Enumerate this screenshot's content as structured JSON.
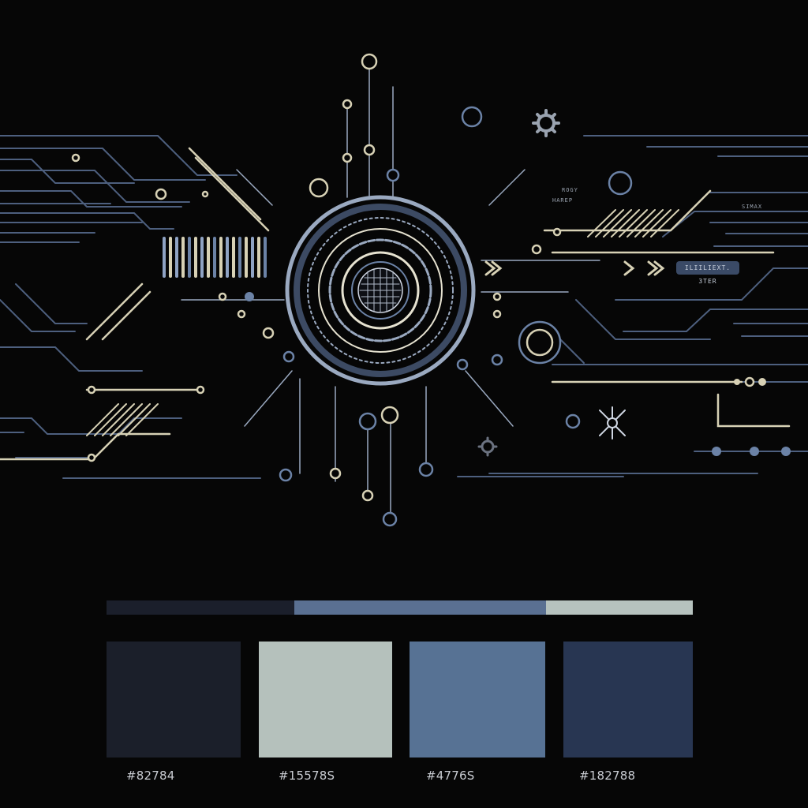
{
  "artwork": {
    "readouts": {
      "top_right": "ROGY",
      "mid_right": "HAREP",
      "far_right": "SIMAX",
      "pill": "ILIILIEXT. 3TER"
    }
  },
  "palette": {
    "strip": [
      {
        "color": "#1b1f2b",
        "fraction": 0.32
      },
      {
        "color": "#5a7092",
        "fraction": 0.43
      },
      {
        "color": "#b6c2be",
        "fraction": 0.25
      }
    ],
    "swatches": [
      {
        "color": "#1b1f2a",
        "label": "#82784"
      },
      {
        "color": "#b5c1bc",
        "label": "#15578S"
      },
      {
        "color": "#577294",
        "label": "#4776S"
      },
      {
        "color": "#283652",
        "label": "#182788"
      }
    ]
  }
}
